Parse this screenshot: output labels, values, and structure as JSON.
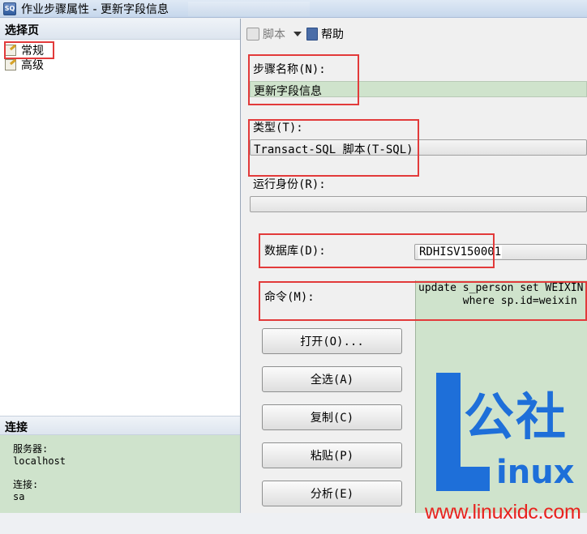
{
  "window": {
    "title": "作业步骤属性 - 更新字段信息",
    "app_icon": "sql-agent-icon"
  },
  "left_panel": {
    "select_page_header": "选择页",
    "pages": [
      {
        "label": "常规",
        "icon": "page-icon"
      },
      {
        "label": "高级",
        "icon": "page-icon"
      }
    ],
    "connection_header": "连接",
    "server_label": "服务器:",
    "server_value": "localhost",
    "connection_label": "连接:",
    "connection_value": "sa"
  },
  "toolbar": {
    "script_label": "脚本",
    "help_label": "帮助"
  },
  "form": {
    "step_name_label": "步骤名称(N):",
    "step_name_value": "更新字段信息",
    "type_label": "类型(T):",
    "type_value": "Transact-SQL 脚本(T-SQL)",
    "run_as_label": "运行身份(R):",
    "run_as_value": "",
    "database_label": "数据库(D):",
    "database_value": "RDHISV150001",
    "command_label": "命令(M):",
    "command_text": "update s_person set WEIXIN\n       where sp.id=weixin",
    "buttons": {
      "open": "打开(O)...",
      "select_all": "全选(A)",
      "copy": "复制(C)",
      "paste": "粘贴(P)",
      "parse": "分析(E)"
    }
  },
  "watermark": {
    "logo_text": "公社",
    "logo_sub": "inux",
    "url": "www.linuxidc.com"
  },
  "colors": {
    "highlight_box": "#e23a3a",
    "field_green": "#cfe3cc",
    "watermark_blue": "#1e6fd9",
    "watermark_red": "#e8221e"
  }
}
